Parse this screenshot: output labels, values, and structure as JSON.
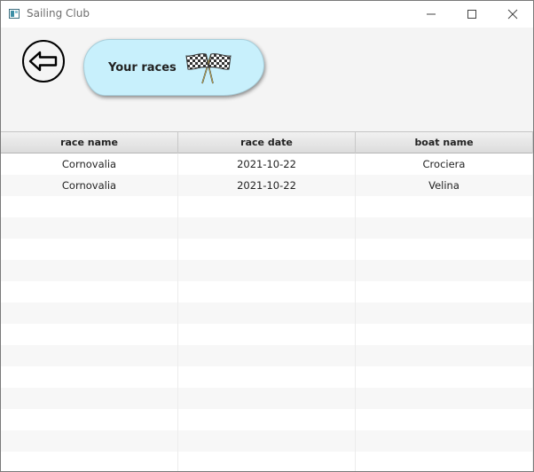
{
  "window": {
    "title": "Sailing Club",
    "icons": {
      "app": "app-window-icon",
      "minimize": "minimize-icon",
      "maximize": "maximize-icon",
      "close": "close-icon"
    }
  },
  "header": {
    "back_icon": "arrow-left-icon",
    "banner_label": "Your races",
    "banner_icon": "checkered-flags-icon",
    "banner_color": "#c8f0fc"
  },
  "table": {
    "columns": [
      "race name",
      "race date",
      "boat name"
    ],
    "rows": [
      [
        "Cornovalia",
        "2021-10-22",
        "Crociera"
      ],
      [
        "Cornovalia",
        "2021-10-22",
        "Velina"
      ]
    ]
  }
}
